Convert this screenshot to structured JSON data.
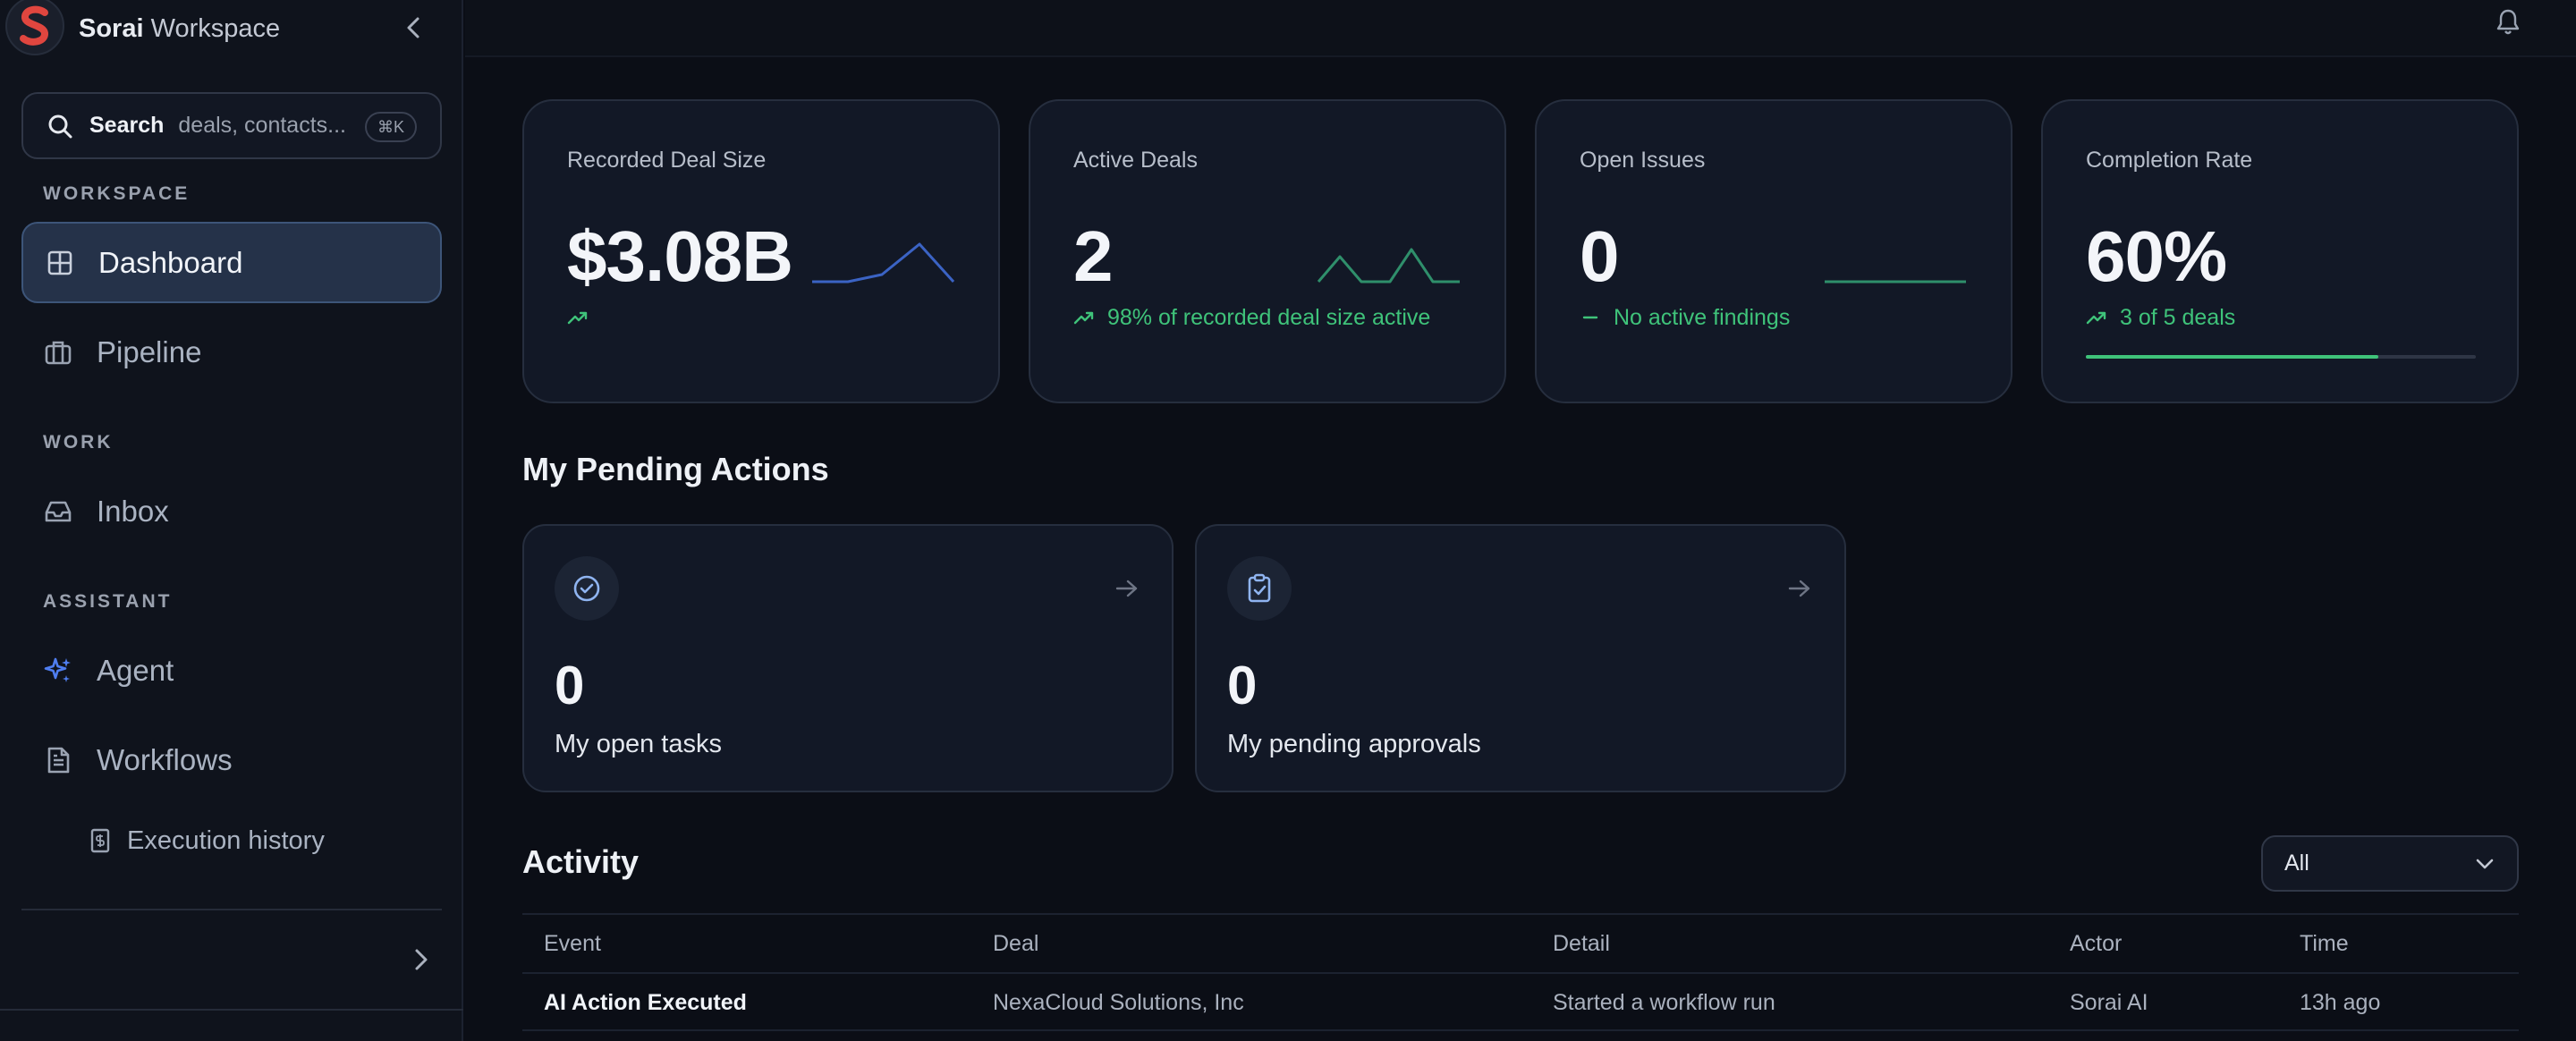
{
  "brand": {
    "name_bold": "Sorai",
    "name_rest": "Workspace"
  },
  "search": {
    "label": "Search",
    "placeholder": "deals, contacts...",
    "shortcut": "⌘K"
  },
  "sidebar": {
    "sections": {
      "workspace": "WORKSPACE",
      "work": "WORK",
      "assistant": "ASSISTANT"
    },
    "items": [
      {
        "label": "Dashboard",
        "icon": "dashboard-grid-icon",
        "active": true
      },
      {
        "label": "Pipeline",
        "icon": "briefcase-icon",
        "active": false
      },
      {
        "label": "Inbox",
        "icon": "inbox-icon",
        "active": false
      },
      {
        "label": "Agent",
        "icon": "sparkles-icon",
        "active": false
      },
      {
        "label": "Workflows",
        "icon": "document-icon",
        "active": false
      }
    ],
    "sub_items": [
      {
        "label": "Execution history",
        "icon": "receipt-icon"
      }
    ]
  },
  "stats": [
    {
      "title": "Recorded Deal Size",
      "value": "$3.08B",
      "sub": "",
      "spark_color": "#3b63c4"
    },
    {
      "title": "Active Deals",
      "value": "2",
      "sub": "98% of recorded deal size active",
      "spark_color": "#2f8f6b"
    },
    {
      "title": "Open Issues",
      "value": "0",
      "sub": "No active findings",
      "spark_color": "#2f8f6b"
    },
    {
      "title": "Completion Rate",
      "value": "60%",
      "sub": "3 of 5 deals",
      "progress": 0.75
    }
  ],
  "pending": {
    "title": "My Pending Actions",
    "cards": [
      {
        "count": "0",
        "label": "My open tasks",
        "icon": "check-circle-icon"
      },
      {
        "count": "0",
        "label": "My pending approvals",
        "icon": "clipboard-check-icon"
      }
    ]
  },
  "activity": {
    "title": "Activity",
    "filter": "All",
    "columns": [
      "Event",
      "Deal",
      "Detail",
      "Actor",
      "Time"
    ],
    "rows": [
      [
        "AI Action Executed",
        "NexaCloud Solutions, Inc",
        "Started a workflow run",
        "Sorai AI",
        "13h ago"
      ]
    ]
  },
  "colors": {
    "accent": "#3fc37a",
    "active_nav": "#253249",
    "background": "#0b0e16"
  }
}
